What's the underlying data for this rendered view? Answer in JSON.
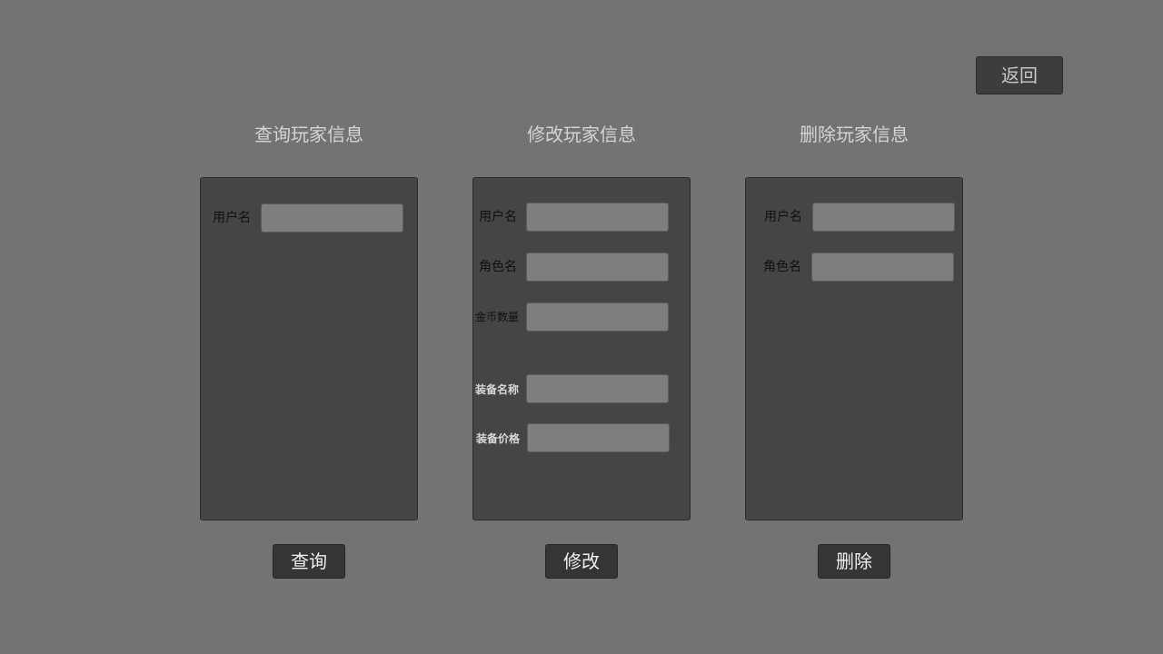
{
  "header": {
    "back_label": "返回"
  },
  "query": {
    "title": "查询玩家信息",
    "fields": [
      {
        "label": "用户名",
        "value": ""
      }
    ],
    "button_label": "查询"
  },
  "modify": {
    "title": "修改玩家信息",
    "fields": [
      {
        "label": "用户名",
        "value": ""
      },
      {
        "label": "角色名",
        "value": ""
      },
      {
        "label": "金币数量",
        "value": ""
      },
      {
        "label": "装备名称",
        "value": ""
      },
      {
        "label": "装备价格",
        "value": ""
      }
    ],
    "button_label": "修改"
  },
  "delete": {
    "title": "删除玩家信息",
    "fields": [
      {
        "label": "用户名",
        "value": ""
      },
      {
        "label": "角色名",
        "value": ""
      }
    ],
    "button_label": "删除"
  }
}
